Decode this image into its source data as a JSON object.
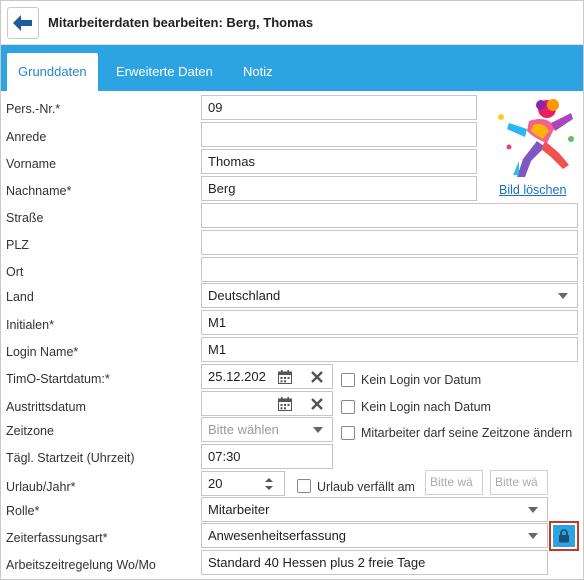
{
  "header": {
    "title": "Mitarbeiterdaten bearbeiten: Berg, Thomas"
  },
  "tabs": [
    {
      "label": "Grunddaten",
      "active": true
    },
    {
      "label": "Erweiterte Daten",
      "active": false
    },
    {
      "label": "Notiz",
      "active": false
    }
  ],
  "colors": {
    "accent": "#2ea3e1",
    "active_tab_text": "#2a85c8",
    "lock_border": "#c0392b"
  },
  "form": {
    "persnr": {
      "label": "Pers.-Nr.*",
      "value": "09"
    },
    "anrede": {
      "label": "Anrede",
      "value": ""
    },
    "vorname": {
      "label": "Vorname",
      "value": "Thomas"
    },
    "nachname": {
      "label": "Nachname*",
      "value": "Berg"
    },
    "strasse": {
      "label": "Straße",
      "value": ""
    },
    "plz": {
      "label": "PLZ",
      "value": ""
    },
    "ort": {
      "label": "Ort",
      "value": ""
    },
    "land": {
      "label": "Land",
      "value": "Deutschland"
    },
    "initialen": {
      "label": "Initialen*",
      "value": "M1"
    },
    "loginname": {
      "label": "Login Name*",
      "value": "M1"
    },
    "startdatum": {
      "label": "TimO-Startdatum:*",
      "value": "25.12.202",
      "checkbox_label": "Kein Login vor Datum"
    },
    "austritt": {
      "label": "Austrittsdatum",
      "value": "",
      "checkbox_label": "Kein Login nach Datum"
    },
    "zeitzone": {
      "label": "Zeitzone",
      "placeholder": "Bitte wählen",
      "checkbox_label": "Mitarbeiter darf seine Zeitzone ändern"
    },
    "startzeit": {
      "label": "Tägl. Startzeit (Uhrzeit)",
      "value": "07:30"
    },
    "urlaub": {
      "label": "Urlaub/Jahr*",
      "value": "20",
      "checkbox_label": "Urlaub verfällt am",
      "select1": "Bitte wä",
      "select2": "Bitte wä"
    },
    "rolle": {
      "label": "Rolle*",
      "value": "Mitarbeiter"
    },
    "zeiterfassung": {
      "label": "Zeiterfassungsart*",
      "value": "Anwesenheitserfassung"
    },
    "arbeitszeit": {
      "label": "Arbeitszeitregelung Wo/Mo",
      "value": "Standard 40 Hessen plus 2 freie Tage"
    }
  },
  "photo": {
    "delete_link": "Bild löschen",
    "icon": "runner-illustration"
  },
  "icons": {
    "back": "arrow-left-icon",
    "calendar": "calendar-icon",
    "clear": "close-icon",
    "lock": "lock-icon",
    "spinner": "spinner-icon"
  }
}
